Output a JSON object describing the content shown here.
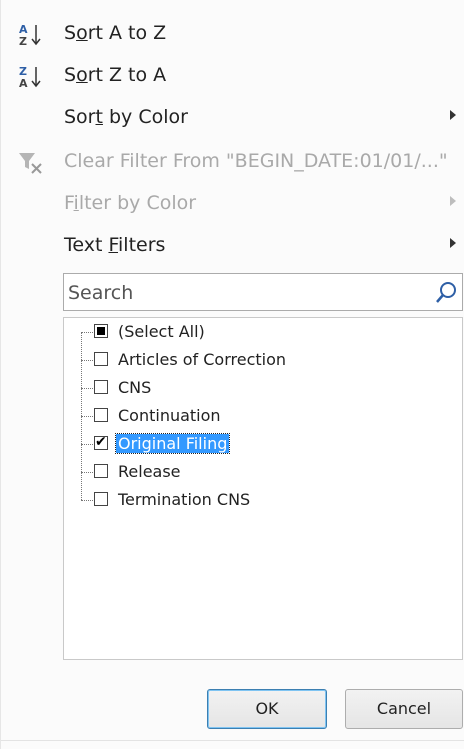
{
  "menu": {
    "sort_az": {
      "label_pre": "S",
      "label_u": "o",
      "label_post": "rt A to Z",
      "icon": "sort-ascending-icon",
      "icon_top": "A",
      "icon_bottom": "Z"
    },
    "sort_za": {
      "label_pre": "S",
      "label_u": "o",
      "label_post": "rt Z to A",
      "icon": "sort-descending-icon",
      "icon_top": "Z",
      "icon_bottom": "A"
    },
    "sort_color": {
      "label_pre": "Sor",
      "label_u": "t",
      "label_post": " by Color"
    },
    "clear_filter": {
      "label": "Clear Filter From \"BEGIN_DATE:01/01/...\"",
      "icon": "clear-filter-icon",
      "disabled": true
    },
    "filter_color": {
      "label_pre": "F",
      "label_u": "i",
      "label_post": "lter by Color",
      "disabled": true
    },
    "text_filters": {
      "label_pre": "Text ",
      "label_u": "F",
      "label_post": "ilters"
    }
  },
  "search": {
    "placeholder": "Search",
    "value": ""
  },
  "list": {
    "items": [
      {
        "label": "(Select All)",
        "state": "partial"
      },
      {
        "label": "Articles of Correction",
        "state": "unchecked"
      },
      {
        "label": "CNS",
        "state": "unchecked"
      },
      {
        "label": "Continuation",
        "state": "unchecked"
      },
      {
        "label": "Original Filing",
        "state": "checked",
        "selected": true
      },
      {
        "label": "Release",
        "state": "unchecked"
      },
      {
        "label": "Termination CNS",
        "state": "unchecked"
      }
    ]
  },
  "buttons": {
    "ok": "OK",
    "cancel": "Cancel"
  },
  "colors": {
    "accent_blue": "#2e5fa6",
    "selection": "#3399ff",
    "disabled_text": "#a9a9a9"
  }
}
